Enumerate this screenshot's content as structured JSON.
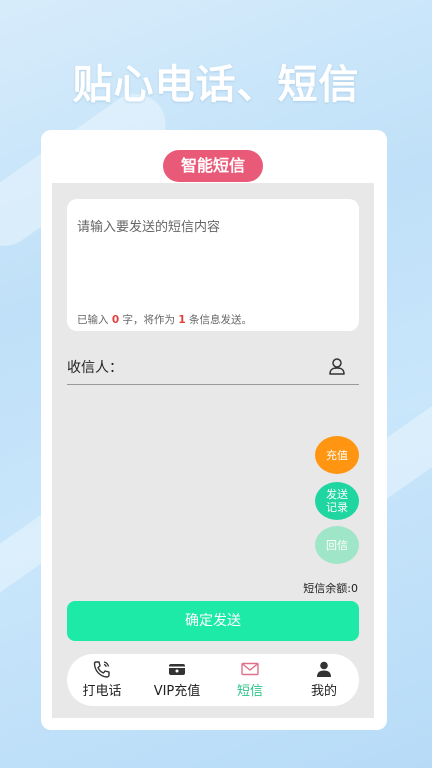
{
  "headline": "贴心电话、短信",
  "card": {
    "title": "智能短信"
  },
  "message": {
    "placeholder": "请输入要发送的短信内容",
    "count_prefix": "已输入",
    "char_count": "0",
    "count_middle": "字，将作为",
    "msg_count": "1",
    "count_suffix": "条信息发送。"
  },
  "recipient": {
    "label": "收信人：",
    "icon": "person-icon"
  },
  "actions": {
    "recharge": "充值",
    "records_line1": "发送",
    "records_line2": "记录",
    "reply": "回信"
  },
  "balance": "短信余额:0",
  "send_button": "确定发送",
  "nav": {
    "items": [
      {
        "label": "打电话",
        "icon": "phone-icon"
      },
      {
        "label": "VIP充值",
        "icon": "wallet-icon"
      },
      {
        "label": "短信",
        "icon": "mail-icon",
        "active": true
      },
      {
        "label": "我的",
        "icon": "user-icon"
      }
    ]
  },
  "colors": {
    "title_pill": "#e85a78",
    "recharge": "#ff9510",
    "records": "#20d6a0",
    "reply": "#9fe6c8",
    "send": "#1deaa6",
    "nav_active": "#2ec48a"
  }
}
